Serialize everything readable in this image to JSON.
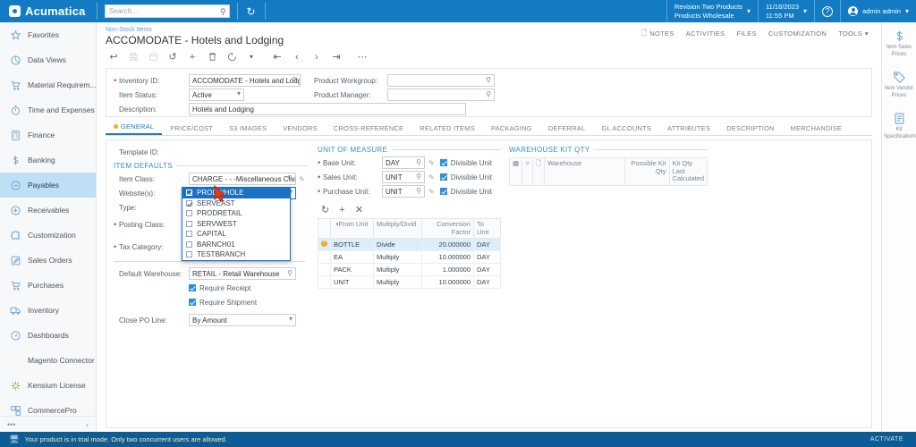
{
  "topbar": {
    "brand": "Acumatica",
    "search_placeholder": "Search...",
    "search_value": "",
    "refresh_icon": "refresh-icon",
    "company": {
      "line1": "Revision Two Products",
      "line2": "Products Wholesale"
    },
    "datetime": {
      "date": "11/16/2023",
      "time": "11:55 PM"
    },
    "help_icon": "help-icon",
    "user": "admin admin"
  },
  "sidebar": {
    "items": [
      {
        "label": "Favorites",
        "icon": "star-icon",
        "active": false
      },
      {
        "label": "Data Views",
        "icon": "pie-chart-icon",
        "active": false
      },
      {
        "label": "Material Requirem...",
        "icon": "cart-icon",
        "active": false
      },
      {
        "label": "Time and Expenses",
        "icon": "stopwatch-icon",
        "active": false
      },
      {
        "label": "Finance",
        "icon": "calculator-icon",
        "active": false
      },
      {
        "label": "Banking",
        "icon": "dollar-icon",
        "active": false
      },
      {
        "label": "Payables",
        "icon": "minus-circle-icon",
        "active": true
      },
      {
        "label": "Receivables",
        "icon": "plus-circle-icon",
        "active": false
      },
      {
        "label": "Customization",
        "icon": "puzzle-icon",
        "active": false
      },
      {
        "label": "Sales Orders",
        "icon": "pencil-square-icon",
        "active": false
      },
      {
        "label": "Purchases",
        "icon": "cart-icon",
        "active": false
      },
      {
        "label": "Inventory",
        "icon": "truck-icon",
        "active": false
      },
      {
        "label": "Dashboards",
        "icon": "gauge-icon",
        "active": false
      },
      {
        "label": "Magento Connector",
        "icon": "",
        "active": false
      },
      {
        "label": "Kensium License",
        "icon": "burst-icon",
        "active": false
      },
      {
        "label": "CommercePro",
        "icon": "blocks-icon",
        "active": false
      }
    ],
    "more_label": "•••",
    "collapse_label": "‹"
  },
  "page": {
    "breadcrumb": "Non-Stock Items",
    "title": "ACCOMODATE - Hotels and Lodging",
    "head_links": [
      {
        "label": "NOTES",
        "icon": "note-icon"
      },
      {
        "label": "ACTIVITIES",
        "icon": ""
      },
      {
        "label": "FILES",
        "icon": ""
      },
      {
        "label": "CUSTOMIZATION",
        "icon": ""
      },
      {
        "label": "TOOLS",
        "icon": "caret-down-icon"
      }
    ],
    "toolbar": [
      {
        "name": "back-button",
        "glyph": "↩",
        "disabled": false
      },
      {
        "name": "save-button",
        "glyph": "Ὃe",
        "disabled": true
      },
      {
        "name": "save-close-button",
        "glyph": "▤",
        "disabled": true
      },
      {
        "name": "undo-button",
        "glyph": "↶",
        "disabled": false
      },
      {
        "name": "add-new-record-button",
        "glyph": "+",
        "disabled": false
      },
      {
        "name": "delete-button",
        "glyph": "Ὕ1",
        "disabled": false
      },
      {
        "name": "actions-button",
        "glyph": "○",
        "disabled": false
      },
      {
        "name": "actions-caret",
        "glyph": "ˇ",
        "disabled": false
      },
      {
        "name": "first-record-button",
        "glyph": "|‹",
        "disabled": false
      },
      {
        "name": "previous-record-button",
        "glyph": "‹",
        "disabled": false
      },
      {
        "name": "next-record-button",
        "glyph": "›",
        "disabled": false
      },
      {
        "name": "last-record-button",
        "glyph": "›|",
        "disabled": false
      },
      {
        "name": "more-button",
        "glyph": "⋯",
        "disabled": false
      }
    ]
  },
  "summary": {
    "inventory_id_label": "Inventory ID:",
    "inventory_id_value": "ACCOMODATE - Hotels and Lodging",
    "item_status_label": "Item Status:",
    "item_status_value": "Active",
    "description_label": "Description:",
    "description_value": "Hotels and Lodging",
    "product_workgroup_label": "Product Workgroup:",
    "product_workgroup_value": "",
    "product_manager_label": "Product Manager:",
    "product_manager_value": ""
  },
  "tabs": [
    {
      "label": "GENERAL",
      "active": true
    },
    {
      "label": "PRICE/COST",
      "active": false
    },
    {
      "label": "S3 IMAGES",
      "active": false
    },
    {
      "label": "VENDORS",
      "active": false
    },
    {
      "label": "CROSS-REFERENCE",
      "active": false
    },
    {
      "label": "RELATED ITEMS",
      "active": false
    },
    {
      "label": "PACKAGING",
      "active": false
    },
    {
      "label": "DEFERRAL",
      "active": false
    },
    {
      "label": "GL ACCOUNTS",
      "active": false
    },
    {
      "label": "ATTRIBUTES",
      "active": false
    },
    {
      "label": "DESCRIPTION",
      "active": false
    },
    {
      "label": "MERCHANDISE",
      "active": false
    }
  ],
  "general": {
    "template_id_label": "Template ID:",
    "template_id_value": "",
    "item_defaults_header": "ITEM DEFAULTS",
    "item_class_label": "Item Class:",
    "item_class_value": "CHARGE   - - -Miscellaneous Charg",
    "websites_label": "Website(s):",
    "websites_value": "PRODWHOLE, SERVEAST",
    "type_label": "Type:",
    "type_value": "",
    "posting_class_label": "Posting Class:",
    "posting_class_value": "",
    "tax_category_label": "Tax Category:",
    "tax_category_value": "",
    "default_warehouse_label": "Default Warehouse:",
    "default_warehouse_value": "RETAIL - Retail Warehouse",
    "require_receipt_label": "Require Receipt",
    "require_receipt_checked": true,
    "require_shipment_label": "Require Shipment",
    "require_shipment_checked": true,
    "close_po_line_label": "Close PO Line:",
    "close_po_line_value": "By Amount",
    "websites_dropdown": {
      "open": true,
      "options": [
        {
          "label": "PRODWHOLE",
          "checked": true,
          "highlighted": true
        },
        {
          "label": "SERVEAST",
          "checked": true,
          "highlighted": false
        },
        {
          "label": "PRODRETAIL",
          "checked": false,
          "highlighted": false
        },
        {
          "label": "SERVWEST",
          "checked": false,
          "highlighted": false
        },
        {
          "label": "CAPITAL",
          "checked": false,
          "highlighted": false
        },
        {
          "label": "BARNCH01",
          "checked": false,
          "highlighted": false
        },
        {
          "label": "TESTBRANCH",
          "checked": false,
          "highlighted": false
        }
      ]
    }
  },
  "uom": {
    "header": "UNIT OF MEASURE",
    "divisible_label": "Divisible Unit",
    "rows": [
      {
        "label": "Base Unit:",
        "value": "DAY",
        "divisible": true
      },
      {
        "label": "Sales Unit:",
        "value": "UNIT",
        "divisible": true
      },
      {
        "label": "Purchase Unit:",
        "value": "UNIT",
        "divisible": true
      }
    ],
    "grid_tools": [
      {
        "name": "refresh-grid-button",
        "glyph": "↻"
      },
      {
        "name": "add-row-button",
        "glyph": "+"
      },
      {
        "name": "delete-row-button",
        "glyph": "×"
      }
    ],
    "columns": [
      "From Unit",
      "Multiply/Divid",
      "Conversion Factor",
      "To Unit"
    ],
    "rows_data": [
      {
        "from_unit": "BOTTLE",
        "op": "Divide",
        "factor": "20.000000",
        "to_unit": "DAY",
        "selected": true,
        "warning": true
      },
      {
        "from_unit": "EA",
        "op": "Multiply",
        "factor": "10.000000",
        "to_unit": "DAY",
        "selected": false,
        "warning": false
      },
      {
        "from_unit": "PACK",
        "op": "Multiply",
        "factor": "1.000000",
        "to_unit": "DAY",
        "selected": false,
        "warning": false
      },
      {
        "from_unit": "UNIT",
        "op": "Multiply",
        "factor": "10.000000",
        "to_unit": "DAY",
        "selected": false,
        "warning": false
      }
    ]
  },
  "warehouse_kit": {
    "header": "WAREHOUSE KIT QTY",
    "columns": [
      "Warehouse",
      "Possible Kit Qty",
      "Kit Qty Last Calculated"
    ],
    "rows_data": []
  },
  "rail": [
    {
      "label": "Item Sales Prices",
      "icon": "dollar-icon"
    },
    {
      "label": "Item Vendor Prices",
      "icon": "tag-icon"
    },
    {
      "label": "Kit Specifications",
      "icon": "document-icon"
    }
  ],
  "statusbar": {
    "message": "Your product is in trial mode. Only two concurrent users are allowed.",
    "icon": "monitor-icon",
    "activate_label": "ACTIVATE"
  }
}
